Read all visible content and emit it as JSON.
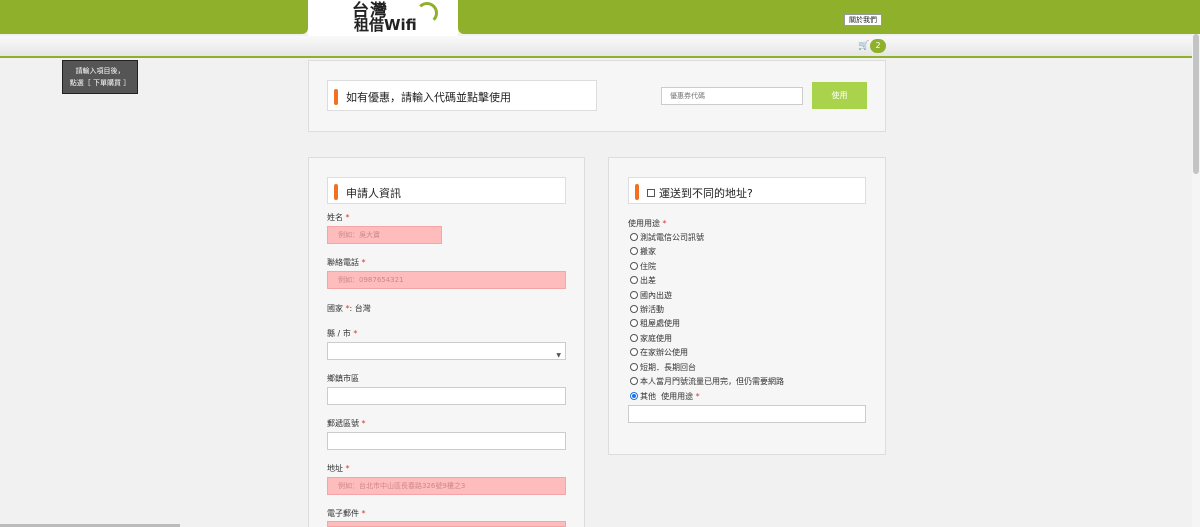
{
  "header": {
    "logo_line1": "台灣",
    "logo_line2": "租借Wifi",
    "about_label": "關於我們",
    "cart_count": "2"
  },
  "tooltip": {
    "line1": "請輸入項目後，",
    "line2": "點選［ 下單購買 ］"
  },
  "coupon": {
    "heading": "如有優惠，請輸入代碼並點擊使用",
    "placeholder": "優惠券代碼",
    "apply_label": "使用"
  },
  "applicant": {
    "heading": "申請人資訊",
    "name_label": "姓名",
    "name_placeholder": "例如：吳大寶",
    "phone_label": "聯絡電話",
    "phone_placeholder": "例如：0987654321",
    "country_label": "國家",
    "country_value": "台灣",
    "city_label": "縣 / 市",
    "district_label": "鄉鎮市區",
    "postcode_label": "郵遞區號",
    "address_label": "地址",
    "address_placeholder": "例如：台北市中山區長春路326號9樓之3",
    "email_label": "電子郵件",
    "required_mark": "*"
  },
  "shipping": {
    "heading": "運送到不同的地址?",
    "purpose_label": "使用用途",
    "options": [
      "測試電信公司訊號",
      "搬家",
      "住院",
      "出差",
      "國內出遊",
      "辦活動",
      "租屋處使用",
      "家庭使用",
      "在家辦公使用",
      "短期．長期回台",
      "本人當月門號流量已用完，但仍需要網路",
      "其他"
    ],
    "other_purpose_label": "使用用途",
    "selected": "其他"
  }
}
